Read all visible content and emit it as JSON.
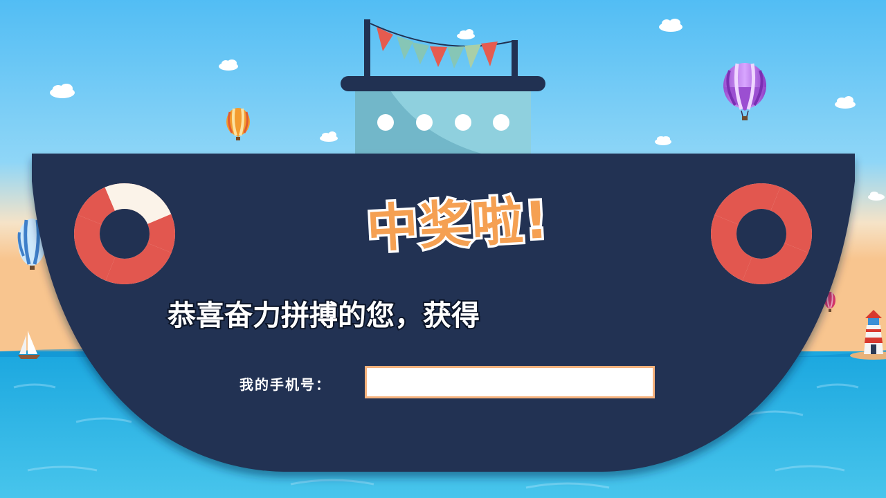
{
  "hero": {
    "title": "中奖啦!",
    "subtitle": "恭喜奋力拼搏的您，获得"
  },
  "form": {
    "phone_label": "我的手机号：",
    "phone_value": "",
    "phone_placeholder": ""
  },
  "colors": {
    "sky_top": "#5dbff5",
    "sea": "#1fa2d8",
    "hull": "#213152",
    "title_fill": "#f5a052",
    "buoy_red": "#e2574f",
    "buoy_cream": "#fbf3e9"
  },
  "icons": {
    "balloons": [
      "hot-air-balloon-icon"
    ],
    "buoys": [
      "life-ring-icon"
    ],
    "flags": "bunting-flags-icon",
    "clouds": "cloud-icon",
    "lighthouse": "lighthouse-icon",
    "sailboat": "sailboat-icon"
  }
}
